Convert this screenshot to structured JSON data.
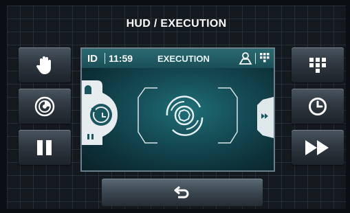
{
  "header": {
    "title": "HUD / EXECUTION"
  },
  "panel": {
    "id_label": "ID",
    "time": "11:59",
    "status": "EXECUTION"
  },
  "icons": {
    "left": [
      "hand-icon",
      "spin-disc-icon",
      "pause-icon"
    ],
    "right": [
      "keypad-icon",
      "clock-icon",
      "fast-forward-icon"
    ],
    "panel": [
      "user-icon",
      "keypad-icon",
      "washer-drum-icon",
      "fast-forward-icon"
    ],
    "footer": [
      "back-icon"
    ]
  },
  "colors": {
    "accent_teal": "#1f6f78",
    "button_gray": "#3a4650"
  }
}
